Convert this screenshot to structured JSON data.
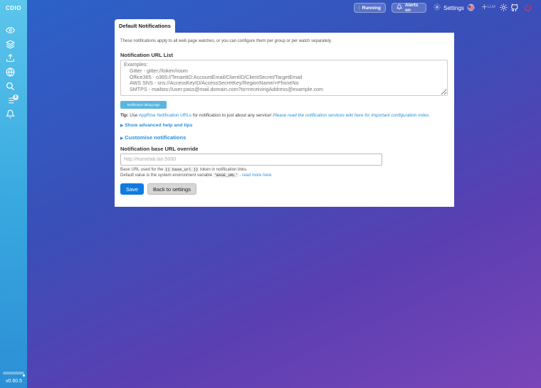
{
  "app": {
    "logo": "CDIO",
    "version": "v0.60.5"
  },
  "sidebar": {
    "items": [
      {
        "icon": "eye-icon"
      },
      {
        "icon": "layers-icon"
      },
      {
        "icon": "upload-icon"
      },
      {
        "icon": "globe-icon"
      },
      {
        "icon": "search-icon"
      },
      {
        "icon": "list-icon",
        "badge": "0"
      },
      {
        "icon": "bell-icon"
      }
    ]
  },
  "topbar": {
    "running_label": "Running",
    "alerts_label": "Alerts on",
    "settings_label": "Settings",
    "llm_label": "LLM"
  },
  "tab": {
    "label": "Default Notifications"
  },
  "notifications": {
    "intro": "These notifications apply to all web page watches, or you can configure them per group or per watch separately.",
    "url_list_label": "Notification URL List",
    "url_list_placeholder": "Examples:\n    Gitter - gitter://token/room\n    Office365 - o365://TenantID:AccountEmail/ClientID/ClientSecret/TargetEmail\n    AWS SNS - sns://AccessKeyID/AccessSecretKey/RegionName/+PhoneNo\n    SMTPS - mailtos://user:pass@mail.domain.com?to=receivingAddress@example.com",
    "debug_button": "Notification debug logs",
    "tip_label": "Tip:",
    "tip_use": "Use",
    "tip_link": "AppRise Notification URLs",
    "tip_middle": "for notification to just about any service!",
    "tip_wiki": "Please read the notification services wiki here for important configuration notes.",
    "advanced_label": "Show advanced help and tips",
    "customise_label": "Customise notifications",
    "base_url_label": "Notification base URL override",
    "base_url_placeholder": "http://homelab.lan:5000",
    "hint_1a": "Base URL used for the",
    "hint_1code": "{{ base_url }}",
    "hint_1b": "token in notification links.",
    "hint_2a": "Default value is the system environment variable",
    "hint_2code": "'BASE_URL'",
    "hint_2b": "-",
    "hint_2link": "read more here."
  },
  "actions": {
    "save": "Save",
    "back": "Back to settings"
  },
  "colors": {
    "accent": "#0f7be0",
    "link": "#2a8fd8",
    "sidebar": "#39a9e0",
    "running": "#2fd37e"
  }
}
